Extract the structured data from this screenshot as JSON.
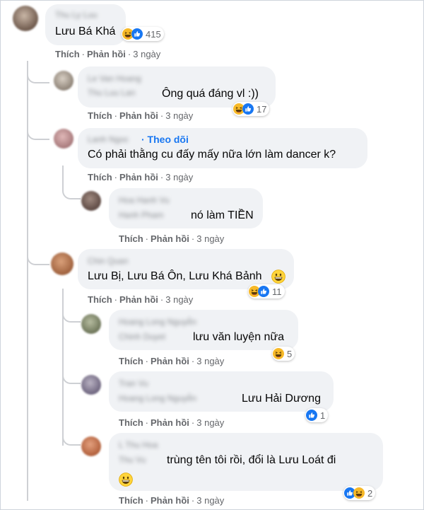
{
  "colors": {
    "bubble": "#f0f2f5",
    "link": "#1877f2",
    "meta": "#65676b",
    "like": "#1877f2",
    "haha": "#f7b928"
  },
  "actions": {
    "like": "Thích",
    "reply": "Phản hồi",
    "separator": "·"
  },
  "comments": [
    {
      "blurred_name": "Thu Ly Luu",
      "text": "Lưu Bá Khá",
      "reactions": [
        "haha-icon",
        "like-icon"
      ],
      "reaction_count": "415",
      "time": "3 ngày"
    },
    {
      "blurred_name": "Le Van Hoang",
      "blurred_name_2": "Thu Luu Lan",
      "text": "Ông quá đáng vl :))",
      "reactions": [
        "haha-icon",
        "like-icon"
      ],
      "reaction_count": "17",
      "time": "3 ngày"
    },
    {
      "blurred_name": "Lanh Ngoc",
      "follow": "· Theo dõi",
      "text": "Có phải thằng cu đấy mấy nữa lớn làm dancer k?",
      "time": "3 ngày"
    },
    {
      "blurred_name": "Hoa Hanh Vu",
      "blurred_name_2": "Hanh Pham",
      "text": "nó làm TIỀN",
      "time": "3 ngày"
    },
    {
      "blurred_name": "Chin Quan",
      "text": "Lưu Bị, Lưu Bá Ôn, Lưu Khá Bảnh",
      "emoji": "grin-emoji",
      "reactions": [
        "haha-icon",
        "like-icon"
      ],
      "reaction_count": "11",
      "time": "3 ngày"
    },
    {
      "blurred_name": "Hoang Long Nguyễn",
      "blurred_name_2": "Chinh Duyet",
      "text": "lưu văn luyện nữa",
      "reactions": [
        "haha-icon"
      ],
      "reaction_count": "5",
      "time": "3 ngày"
    },
    {
      "blurred_name": "Tran Vu",
      "blurred_name_2": "Hoang Long Nguyễn",
      "text": "Lưu Hải Dương",
      "reactions": [
        "like-icon"
      ],
      "reaction_count": "1",
      "time": "3 ngày"
    },
    {
      "blurred_name": "L Thu Hoa",
      "blurred_name_2": "Thu Vu",
      "text": "trùng tên tôi rồi, đổi là Lưu Loát đi",
      "emoji": "grin-emoji",
      "reactions": [
        "like-icon",
        "haha-icon"
      ],
      "reaction_count": "2",
      "time": "3 ngày"
    }
  ]
}
